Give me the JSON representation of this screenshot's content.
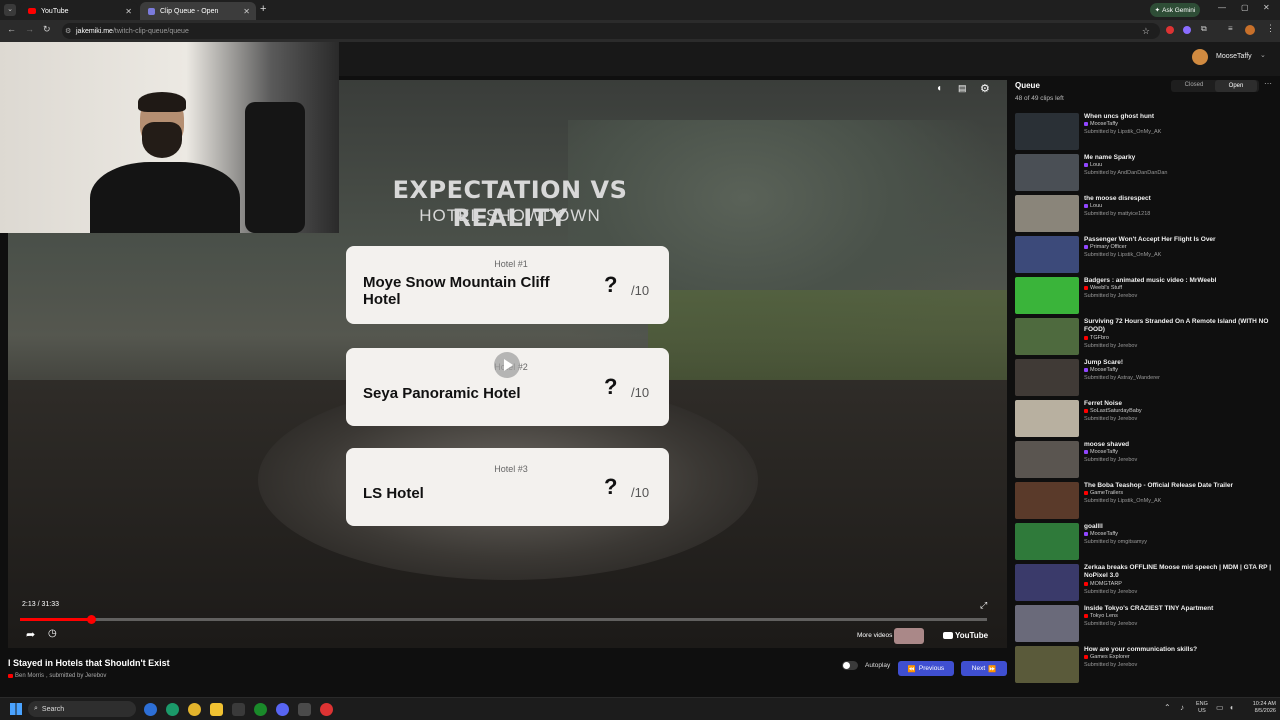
{
  "browser": {
    "tabs": [
      {
        "label": "YouTube",
        "active": false
      },
      {
        "label": "Clip Queue - Open",
        "active": true
      }
    ],
    "url_host": "jakemiki.me",
    "url_path": "/twitch-clip-queue/queue",
    "gemini_label": "Ask Gemini"
  },
  "header": {
    "username": "MooseTaffy"
  },
  "video": {
    "overlay_title": "EXPECTATION VS REALITY",
    "overlay_subtitle": "HOTEL SHOWDOWN",
    "cards": [
      {
        "num": "Hotel #1",
        "name": "Moye Snow Mountain Cliff Hotel",
        "score": "?",
        "outof": "/10"
      },
      {
        "num": "Hotel #2",
        "name": "Seya Panoramic Hotel",
        "score": "?",
        "outof": "/10"
      },
      {
        "num": "Hotel #3",
        "name": "LS Hotel",
        "score": "?",
        "outof": "/10"
      }
    ],
    "time": "2:13 / 31:33",
    "progress_fraction": 0.07,
    "more_videos": "More videos",
    "youtube_label": "YouTube",
    "title": "I Stayed in Hotels that Shouldn't Exist",
    "channel": "Ben Morris",
    "submitted": ", submitted by Jerebov",
    "autoplay_label": "Autoplay",
    "previous_label": "Previous",
    "next_label": "Next"
  },
  "queue": {
    "title": "Queue",
    "count": "48 of 49 clips left",
    "closed_label": "Closed",
    "open_label": "Open",
    "items": [
      {
        "title": "When uncs ghost hunt",
        "channel": "MooseTaffy",
        "submitter": "Submitted by Lipstik_OnMy_AK",
        "color": "#9146ff",
        "thumb": "#2a3036"
      },
      {
        "title": "Me name Sparky",
        "channel": "Louu",
        "submitter": "Submitted by AndDanDanDanDan",
        "color": "#9146ff",
        "thumb": "#4a4f55"
      },
      {
        "title": "the moose disrespect",
        "channel": "Louu",
        "submitter": "Submitted by mattyice1218",
        "color": "#9146ff",
        "thumb": "#8a857a"
      },
      {
        "title": "Passenger Won't Accept Her Flight Is Over",
        "channel": "Primary Officer",
        "submitter": "Submitted by Lipstik_OnMy_AK",
        "color": "#9146ff",
        "thumb": "#3c4a7a"
      },
      {
        "title": "Badgers : animated music video : MrWeebl",
        "channel": "Weebl's Stuff",
        "submitter": "Submitted by Jerebov",
        "color": "#ff0000",
        "thumb": "#3ab43a"
      },
      {
        "title": "Surviving 72 Hours Stranded On A Remote Island (WITH NO FOOD)",
        "channel": "TGFbro",
        "submitter": "Submitted by Jerebov",
        "color": "#ff0000",
        "thumb": "#4e6a3e"
      },
      {
        "title": "Jump Scare!",
        "channel": "MooseTaffy",
        "submitter": "Submitted by Astray_Wanderer",
        "color": "#9146ff",
        "thumb": "#403a36"
      },
      {
        "title": "Ferret Noise",
        "channel": "SoLastSaturdayBaby",
        "submitter": "Submitted by Jerebov",
        "color": "#ff0000",
        "thumb": "#b8b0a0"
      },
      {
        "title": "moose shaved",
        "channel": "MooseTaffy",
        "submitter": "Submitted by Jerebov",
        "color": "#9146ff",
        "thumb": "#5a5550"
      },
      {
        "title": "The Boba Teashop - Official Release Date Trailer",
        "channel": "GameTrailers",
        "submitter": "Submitted by Lipstik_OnMy_AK",
        "color": "#ff0000",
        "thumb": "#5a3a2a"
      },
      {
        "title": "goallll",
        "channel": "MooseTaffy",
        "submitter": "Submitted by omgitsamyy",
        "color": "#9146ff",
        "thumb": "#2f7a3a"
      },
      {
        "title": "Zerkaa breaks OFFLINE Moose mid speech | MDM | GTA RP | NoPixel 3.0",
        "channel": "MOMGTARP",
        "submitter": "Submitted by Jerebov",
        "color": "#ff0000",
        "thumb": "#3a3a6a"
      },
      {
        "title": "Inside Tokyo's CRAZIEST TINY Apartment",
        "channel": "Tokyo Lens",
        "submitter": "Submitted by Jerebov",
        "color": "#ff0000",
        "thumb": "#6a6a7a"
      },
      {
        "title": "How are your communication skills?",
        "channel": "Games Explorer",
        "submitter": "Submitted by Jerebov",
        "color": "#ff0000",
        "thumb": "#5a5a3a"
      }
    ]
  },
  "taskbar": {
    "search_label": "Search",
    "lang": "ENG",
    "region": "US",
    "time": "10:24 AM",
    "date": "8/5/2026"
  }
}
